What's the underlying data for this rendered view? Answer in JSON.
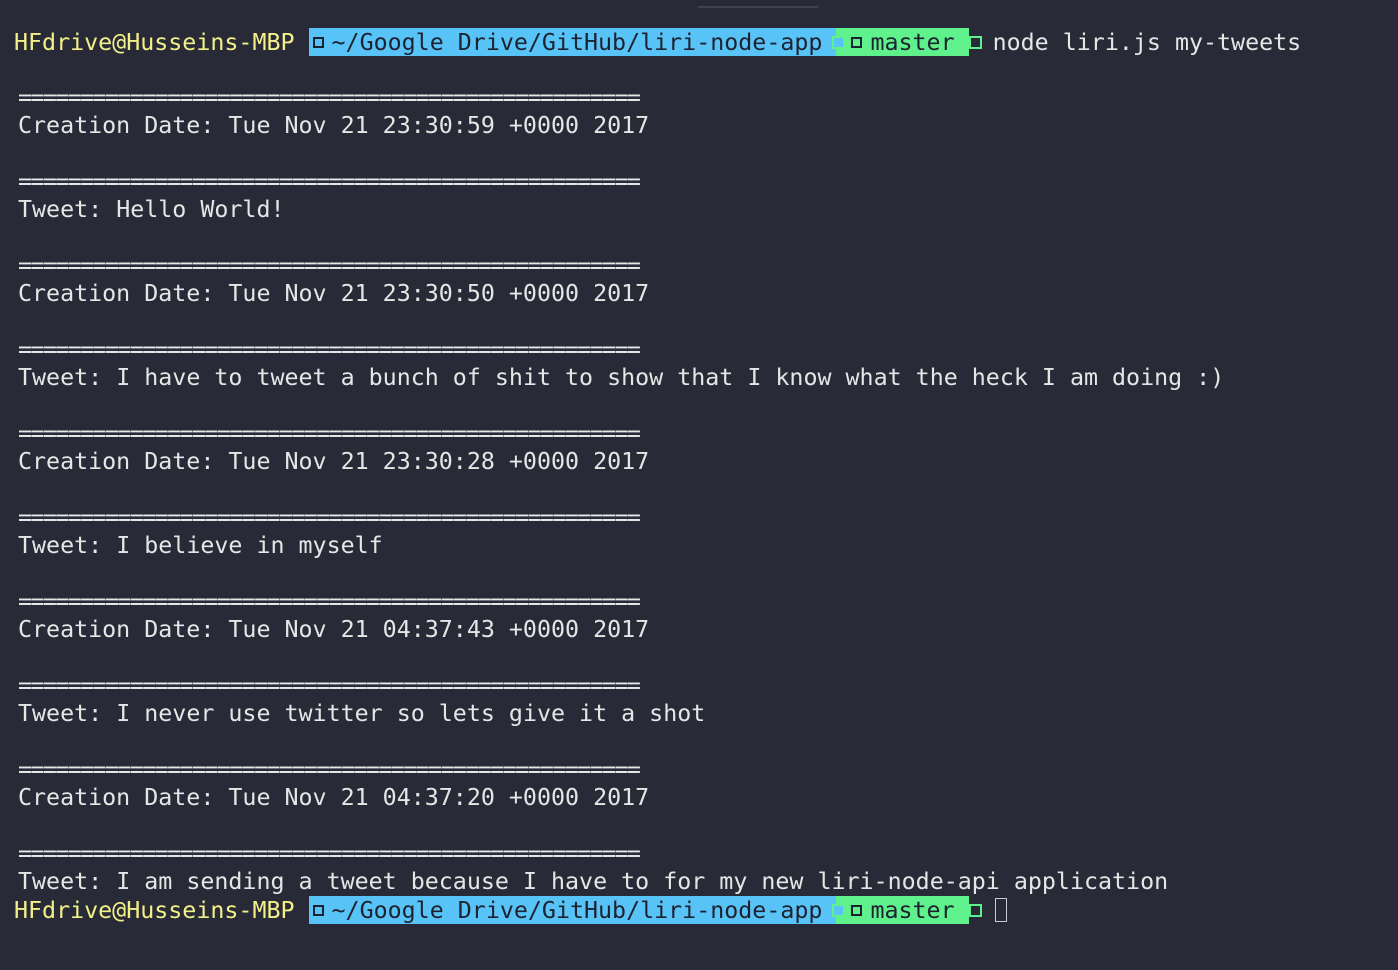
{
  "prompt": {
    "user_host": "HFdrive@Husseins-MBP",
    "path": "~/Google Drive/GitHub/liri-node-app",
    "branch": "master",
    "command": "node liri.js my-tweets"
  },
  "separator": "==================================================",
  "output": [
    {
      "label": "Creation Date: ",
      "value": "Tue Nov 21 23:30:59 +0000 2017"
    },
    {
      "label": "Tweet: ",
      "value": "Hello World!"
    },
    {
      "label": "Creation Date: ",
      "value": "Tue Nov 21 23:30:50 +0000 2017"
    },
    {
      "label": "Tweet: ",
      "value": "I have to tweet a bunch of shit to show that I know what the heck I am doing :)"
    },
    {
      "label": "Creation Date: ",
      "value": "Tue Nov 21 23:30:28 +0000 2017"
    },
    {
      "label": "Tweet: ",
      "value": "I believe in myself"
    },
    {
      "label": "Creation Date: ",
      "value": "Tue Nov 21 04:37:43 +0000 2017"
    },
    {
      "label": "Tweet: ",
      "value": "I never use twitter so lets give it a shot"
    },
    {
      "label": "Creation Date: ",
      "value": "Tue Nov 21 04:37:20 +0000 2017"
    },
    {
      "label": "Tweet: ",
      "value": "I am sending a tweet because I have to for my new liri-node-api application"
    }
  ],
  "colors": {
    "background": "#282b37",
    "user": "#f3f08a",
    "path_segment": "#58c3f7",
    "branch_segment": "#5ff28c",
    "text": "#e6e6e6"
  }
}
